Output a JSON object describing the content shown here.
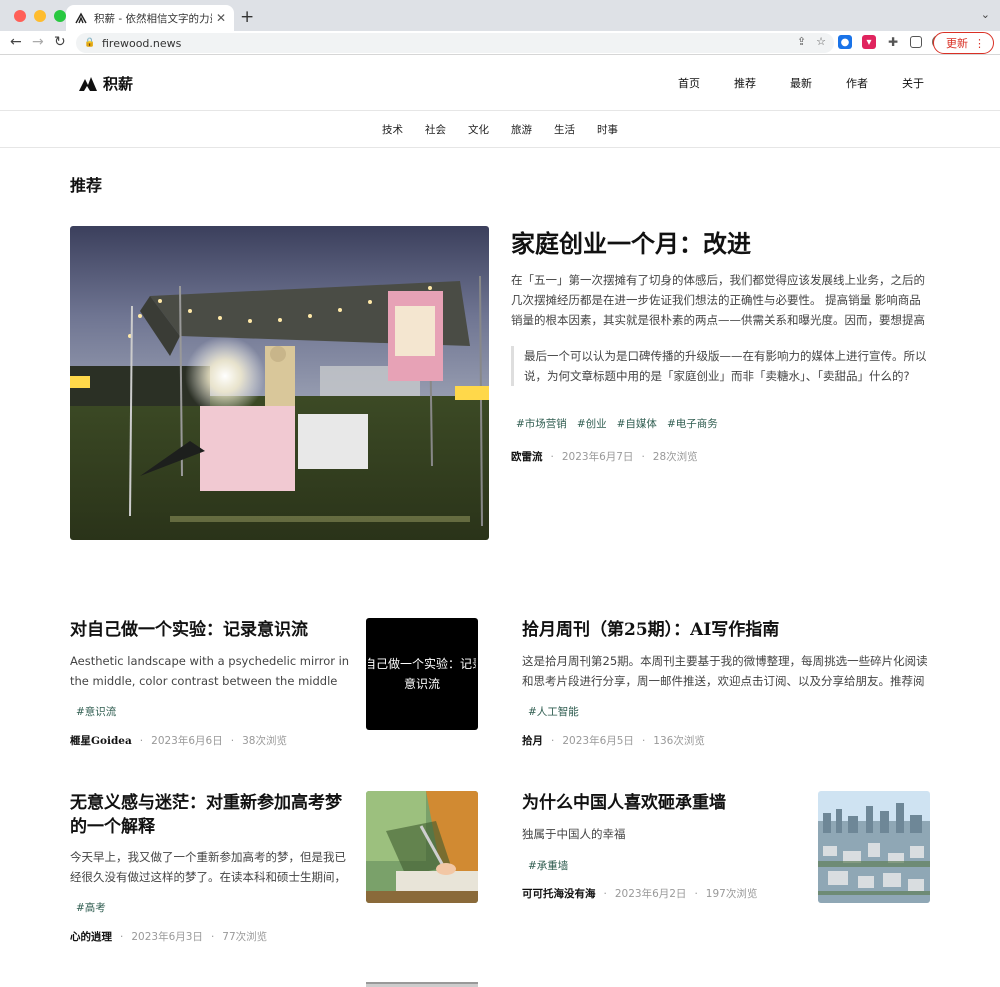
{
  "browser": {
    "tab_title": "积薪 - 依然相信文字的力量",
    "url": "firewood.news",
    "update_label": "更新"
  },
  "site": {
    "logo_text": "积薪",
    "nav": [
      "首页",
      "推荐",
      "最新",
      "作者",
      "关于"
    ],
    "categories": [
      "技术",
      "社会",
      "文化",
      "旅游",
      "生活",
      "时事"
    ]
  },
  "section_title": "推荐",
  "featured": {
    "title": "家庭创业一个月：改进",
    "excerpt": "在「五一」第一次摆摊有了切身的体感后，我们都觉得应该发展线上业务，之后的几次摆摊经历都是在进一步佐证我们想法的正确性与必要性。 提高销量 影响商品销量的根本因素，其实就是很朴素的两点——供需关系和曝光度。因而，要想提高销量...",
    "quote": "最后一个可以认为是口碑传播的升级版——在有影响力的媒体上进行宣传。所以说，为何文章标题中用的是「家庭创业」而非「卖糖水」、「卖甜品」什么的?",
    "tags": [
      "#市场营销",
      "#创业",
      "#自媒体",
      "#电子商务"
    ],
    "author": "欧雷流",
    "date": "2023年6月7日",
    "views": "28次浏览"
  },
  "cards": [
    {
      "title": "对自己做一个实验：记录意识流",
      "excerpt": "Aesthetic landscape with a psychedelic mirror in the middle, color contrast between the middle and outer ...",
      "tag": "#意识流",
      "author": "榧星Goidea",
      "date": "2023年6月6日",
      "views": "38次浏览",
      "thumb_line1": "自己做一个实验：记录",
      "thumb_line2": "意识流"
    },
    {
      "title": "拾月周刊（第25期）：AI写作指南",
      "excerpt": "这是拾月周刊第25期。本周刊主要基于我的微博整理，每周挑选一些碎片化阅读和思考片段进行分享，周一邮件推送，欢迎点击订阅、以及分享给朋友。推荐阅读...",
      "tag": "#人工智能",
      "author": "拾月",
      "date": "2023年6月5日",
      "views": "136次浏览"
    },
    {
      "title": "无意义感与迷茫：对重新参加高考梦的一个解释",
      "excerpt": "今天早上，我又做了一个重新参加高考的梦，但是我已经很久没有做过这样的梦了。在读本科和硕士生期间，我...",
      "tag": "#高考",
      "author": "心的逍理",
      "date": "2023年6月3日",
      "views": "77次浏览"
    },
    {
      "title": "为什么中国人喜欢砸承重墙",
      "excerpt": "独属于中国人的幸福",
      "tag": "#承重墙",
      "author": "可可托海没有海",
      "date": "2023年6月2日",
      "views": "197次浏览"
    }
  ],
  "colors": {
    "tag": "#2f5d50",
    "accent_update": "#d93025"
  }
}
